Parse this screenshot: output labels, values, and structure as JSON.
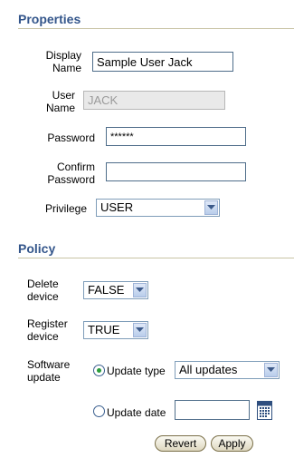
{
  "properties": {
    "title": "Properties",
    "display_name_label_1": "Display",
    "display_name_label_2": "Name",
    "display_name_value": "Sample User Jack",
    "user_name_label_1": "User",
    "user_name_label_2": "Name",
    "user_name_value": "JACK",
    "password_label": "Password",
    "password_value": "******",
    "confirm_label_1": "Confirm",
    "confirm_label_2": "Password",
    "confirm_value": "",
    "privilege_label": "Privilege",
    "privilege_value": "USER"
  },
  "policy": {
    "title": "Policy",
    "delete_label_1": "Delete",
    "delete_label_2": "device",
    "delete_value": "FALSE",
    "register_label_1": "Register",
    "register_label_2": "device",
    "register_value": "TRUE",
    "software_label_1": "Software",
    "software_label_2": "update",
    "update_type_label": "Update type",
    "update_type_value": "All updates",
    "update_date_label": "Update date",
    "update_date_value": "",
    "selected_option": "Update type"
  },
  "actions": {
    "revert": "Revert",
    "apply": "Apply"
  },
  "colors": {
    "section_title": "#34568b",
    "radio_selected": "#2a9d3c"
  },
  "icons": {
    "dropdown": "chevron-down-icon",
    "calendar": "calendar-icon"
  }
}
